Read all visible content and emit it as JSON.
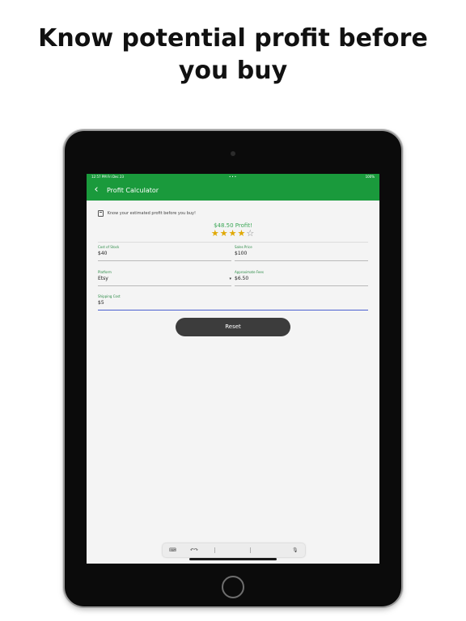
{
  "headline": "Know potential profit before\nyou buy",
  "status_bar": {
    "time": "12:57 PM  Fri Dec 23",
    "dots": "•••",
    "battery": "100%"
  },
  "app_bar": {
    "back": "‹",
    "title": "Profit Calculator"
  },
  "intro_text": "Know your estimated profit before you buy!",
  "profit_text": "$48.50 Profit!",
  "rating": {
    "filled": 4,
    "total": 5
  },
  "fields": {
    "cost_of_stock": {
      "label": "Cost of Stock",
      "value": "$40"
    },
    "sales_price": {
      "label": "Sales Price",
      "value": "$100"
    },
    "platform": {
      "label": "Platform",
      "value": "Etsy"
    },
    "approximate_fees": {
      "label": "Approximate Fees",
      "value": "$6.50"
    },
    "shipping_cost": {
      "label": "Shipping Cost",
      "value": "$5"
    }
  },
  "reset_label": "Reset",
  "icons": {
    "calculator": "calculator-icon",
    "dropdown": "chevron-down-icon",
    "keyboard": "keyboard-icon",
    "microphone": "microphone-icon"
  },
  "colors": {
    "brand": "#1a9a3c",
    "profit": "#3aa655",
    "star": "#e0a800",
    "reset": "#3c3c3c"
  }
}
